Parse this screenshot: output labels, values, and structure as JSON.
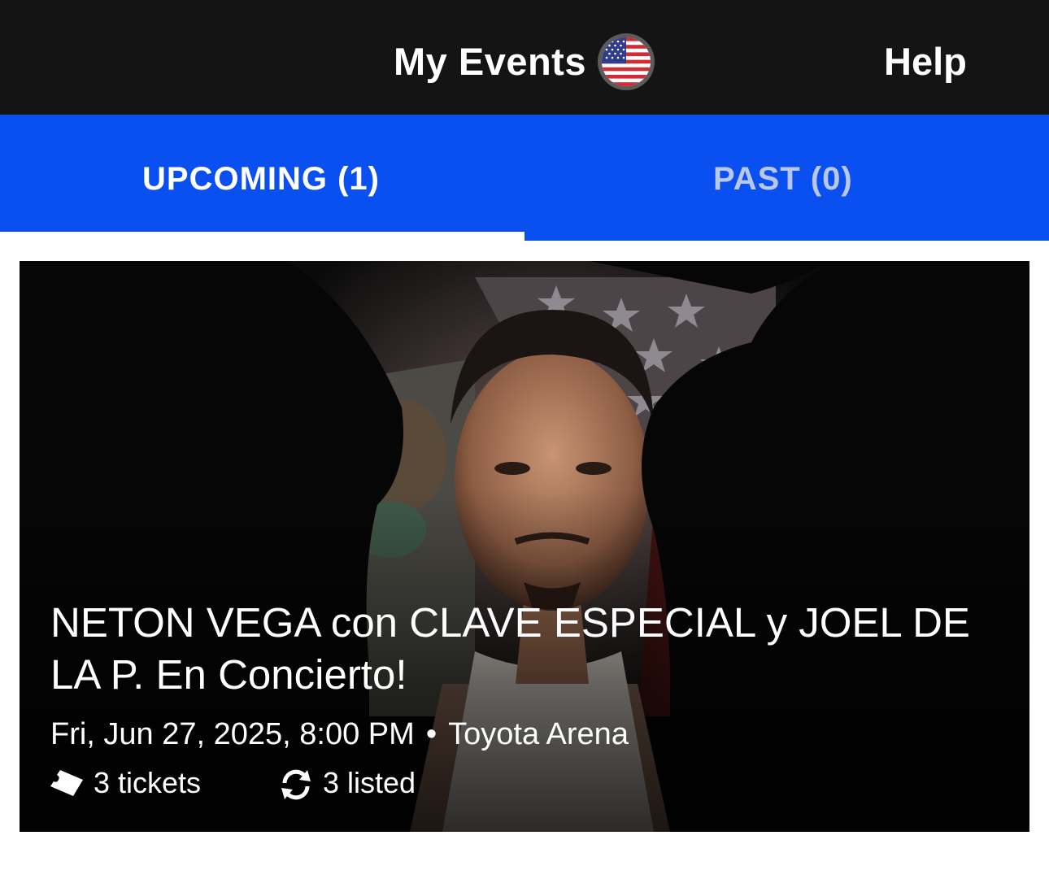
{
  "header": {
    "title": "My Events",
    "help_label": "Help",
    "region_icon": "us-flag-icon"
  },
  "tabs": [
    {
      "label": "UPCOMING (1)",
      "selected": true
    },
    {
      "label": "PAST (0)",
      "selected": false
    }
  ],
  "events": [
    {
      "title": "NETON VEGA con CLAVE ESPECIAL y JOEL DE LA P. En Concierto!",
      "date": "Fri, Jun 27, 2025, 8:00 PM",
      "separator": "•",
      "venue": "Toyota Arena",
      "tickets": "3 tickets",
      "listed": "3 listed",
      "ticket_icon": "ticket-icon",
      "listed_icon": "refresh-icon"
    }
  ],
  "colors": {
    "header_bg": "#141414",
    "tab_bg": "#0a4ff0",
    "tab_inactive_text": "#b9c8ea",
    "text": "#ffffff"
  }
}
